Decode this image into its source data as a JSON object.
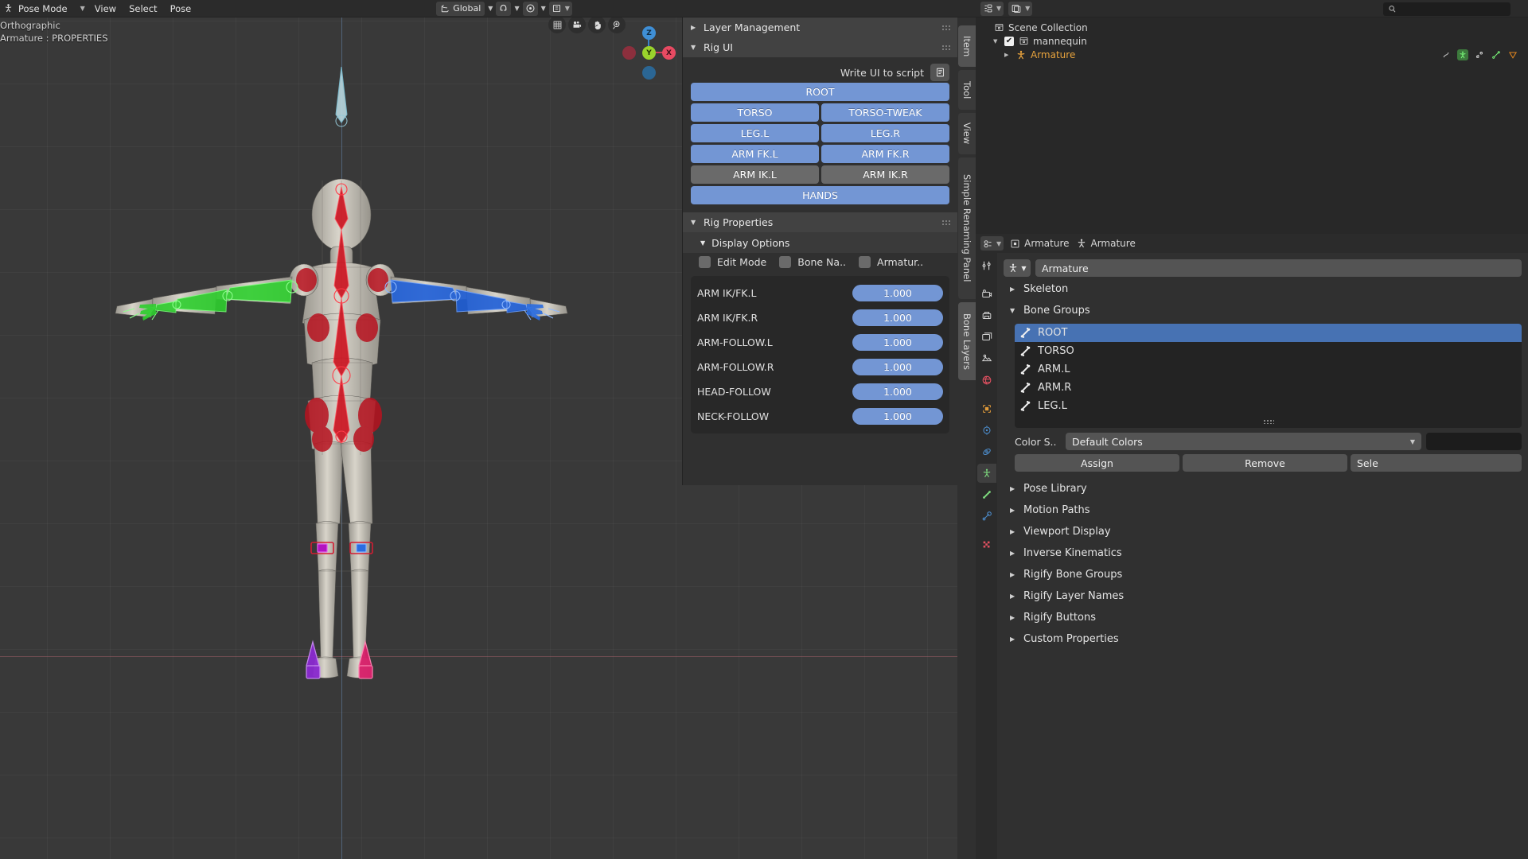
{
  "viewport_header": {
    "mode": "Pose Mode",
    "mode_icon": "pose-mode-icon",
    "menus": [
      "View",
      "Select",
      "Pose"
    ],
    "transform_orientation": "Global",
    "snap_icon": "magnet-icon",
    "proportional_icon": "proportional-edit-icon",
    "overlay_icons": [
      "visibility-icon",
      "gizmo-icon",
      "overlays-icon",
      "xray-icon"
    ],
    "shading_modes": [
      "wireframe-icon",
      "solid-icon",
      "material-preview-icon",
      "rendered-icon"
    ],
    "shading_active": "solid-icon"
  },
  "viewport": {
    "view_label": "Orthographic",
    "object_label": "Armature : PROPERTIES",
    "nav_buttons": [
      "grid-toggle-icon",
      "camera-view-icon",
      "pan-hand-icon",
      "zoom-magnifier-icon"
    ],
    "gizmo_axes": [
      "Z",
      "Y",
      "X"
    ]
  },
  "npanel": {
    "tabs": [
      "Item",
      "Tool",
      "View",
      "Simple Renaming Panel",
      "Bone Layers"
    ],
    "active_tab": "Item",
    "layer_management": {
      "title": "Layer Management",
      "expanded": false
    },
    "rig_ui": {
      "title": "Rig UI",
      "expanded": true,
      "write_script_label": "Write UI to script",
      "write_script_icon": "script-icon",
      "rows": [
        [
          "ROOT"
        ],
        [
          "TORSO",
          "TORSO-TWEAK"
        ],
        [
          "LEG.L",
          "LEG.R"
        ],
        [
          "ARM FK.L",
          "ARM FK.R"
        ],
        [
          "ARM IK.L",
          "ARM IK.R"
        ],
        [
          "HANDS"
        ]
      ],
      "inactive_buttons": [
        "ARM IK.L",
        "ARM IK.R"
      ]
    },
    "rig_properties": {
      "title": "Rig Properties",
      "expanded": true,
      "display_options": {
        "title": "Display Options",
        "expanded": true,
        "checkboxes": [
          {
            "label": "Edit Mode",
            "checked": false
          },
          {
            "label": "Bone Na..",
            "checked": false
          },
          {
            "label": "Armatur..",
            "checked": false
          }
        ]
      },
      "properties": [
        {
          "name": "ARM IK/FK.L",
          "value": "1.000"
        },
        {
          "name": "ARM IK/FK.R",
          "value": "1.000"
        },
        {
          "name": "ARM-FOLLOW.L",
          "value": "1.000"
        },
        {
          "name": "ARM-FOLLOW.R",
          "value": "1.000"
        },
        {
          "name": "HEAD-FOLLOW",
          "value": "1.000"
        },
        {
          "name": "NECK-FOLLOW",
          "value": "1.000"
        }
      ]
    }
  },
  "outliner": {
    "header_icons": [
      "editor-type-icon",
      "display-mode-icon",
      "filter-icon"
    ],
    "search_placeholder": "",
    "search_value": "",
    "search_icon": "search-icon",
    "rows": [
      {
        "label": "Scene Collection",
        "icon": "collection-icon",
        "depth": 0,
        "expandable": false,
        "checkbox": false
      },
      {
        "label": "mannequin",
        "icon": "collection-icon",
        "depth": 1,
        "expandable": true,
        "checkbox": true
      },
      {
        "label": "Armature",
        "icon": "armature-object-icon",
        "depth": 2,
        "expandable": true,
        "checkbox": false,
        "highlight": true,
        "trailing_icons": [
          "animation-icon",
          "pose-icon",
          "modifier-icon",
          "bone-icon",
          "mesh-data-icon"
        ]
      }
    ]
  },
  "properties": {
    "breadcrumb": [
      {
        "label": "Armature",
        "icon": "object-icon"
      },
      {
        "label": "Armature",
        "icon": "armature-data-icon"
      }
    ],
    "tab_icons": [
      "tool-icon",
      "render-icon",
      "output-icon",
      "view-layer-icon",
      "scene-icon",
      "world-icon",
      "object-icon",
      "modifier-icon",
      "physics-icon",
      "object-constraint-icon",
      "armature-data-icon",
      "bone-icon",
      "bone-constraint-icon",
      "material-icon"
    ],
    "active_tab": "armature-data-icon",
    "id_block": {
      "icon": "armature-data-icon",
      "name": "Armature"
    },
    "sections": [
      {
        "label": "Skeleton",
        "expanded": false
      },
      {
        "label": "Bone Groups",
        "expanded": true
      },
      {
        "label": "Pose Library",
        "expanded": false
      },
      {
        "label": "Motion Paths",
        "expanded": false
      },
      {
        "label": "Viewport Display",
        "expanded": false
      },
      {
        "label": "Inverse Kinematics",
        "expanded": false
      },
      {
        "label": "Rigify Bone Groups",
        "expanded": false
      },
      {
        "label": "Rigify Layer Names",
        "expanded": false
      },
      {
        "label": "Rigify Buttons",
        "expanded": false
      },
      {
        "label": "Custom Properties",
        "expanded": false
      }
    ],
    "bone_groups": {
      "items": [
        {
          "label": "ROOT",
          "selected": true
        },
        {
          "label": "TORSO",
          "selected": false
        },
        {
          "label": "ARM.L",
          "selected": false
        },
        {
          "label": "ARM.R",
          "selected": false
        },
        {
          "label": "LEG.L",
          "selected": false
        }
      ],
      "color_set_label": "Color S..",
      "color_set_value": "Default Colors",
      "buttons": [
        "Assign",
        "Remove",
        "Sele"
      ]
    }
  },
  "colors": {
    "accent_blue": "#4772b3",
    "button_blue": "#7396d4",
    "panel_bg": "#303030",
    "header_bg": "#2b2b2b",
    "editor_bg": "#282828",
    "orange_text": "#e8a33d"
  }
}
